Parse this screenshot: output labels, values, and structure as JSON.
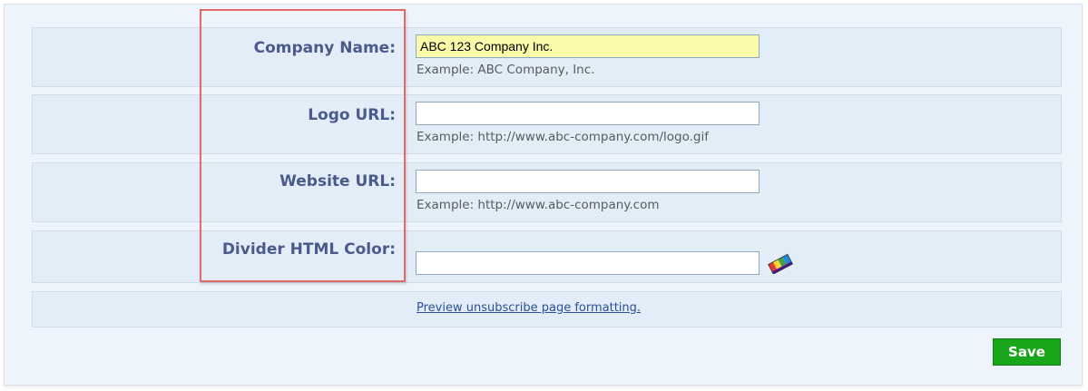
{
  "form": {
    "company_name": {
      "label": "Company Name:",
      "value": "ABC 123 Company Inc.",
      "hint": "Example: ABC Company, Inc."
    },
    "logo_url": {
      "label": "Logo URL:",
      "value": "",
      "hint": "Example: http://www.abc-company.com/logo.gif"
    },
    "website_url": {
      "label": "Website URL:",
      "value": "",
      "hint": "Example: http://www.abc-company.com"
    },
    "divider_color": {
      "label": "Divider HTML Color:",
      "value": "",
      "picker_icon": "color-palette-icon"
    },
    "preview_link": "Preview unsubscribe page formatting.",
    "save_label": "Save"
  },
  "colors": {
    "panel_bg": "#eef4fb",
    "row_bg": "#e3edf8",
    "label_text": "#4a5a8c",
    "highlighted_field_bg": "#fbfaa8",
    "annotation_box": "#e06a6a",
    "save_button": "#1aa61a"
  }
}
